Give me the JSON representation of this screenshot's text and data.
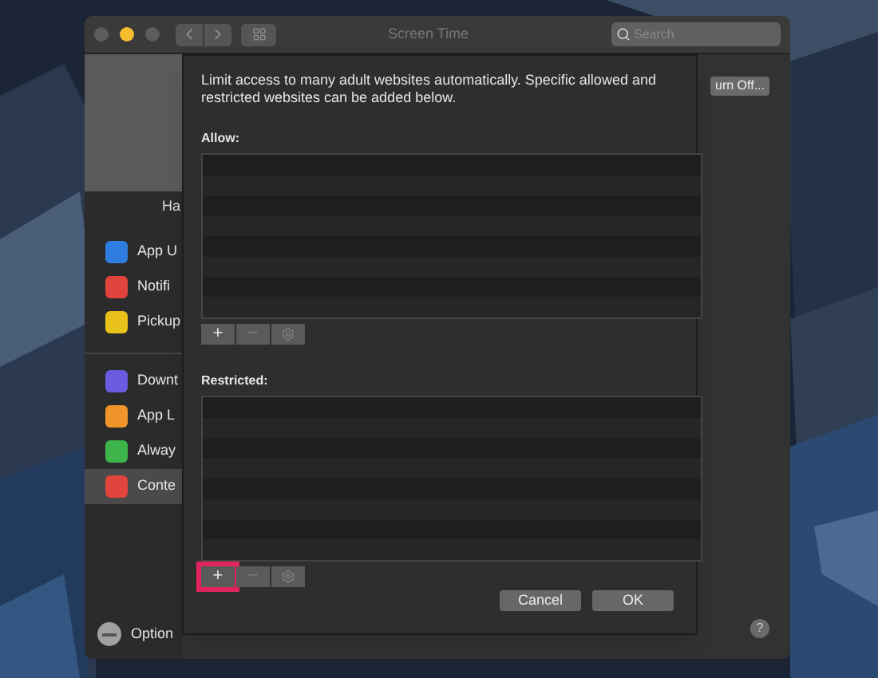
{
  "window": {
    "title": "Screen Time",
    "search": {
      "placeholder": "Search"
    }
  },
  "sidebar": {
    "header": "Ha",
    "sections": [
      {
        "items": [
          {
            "label": "App U",
            "color": "#2f7de1",
            "selected": false
          },
          {
            "label": "Notifi",
            "color": "#e0443c",
            "selected": false
          },
          {
            "label": "Pickup",
            "color": "#e8c21a",
            "selected": false
          }
        ]
      },
      {
        "items": [
          {
            "label": "Downt",
            "color": "#6b5be0",
            "selected": false
          },
          {
            "label": "App L",
            "color": "#f0952a",
            "selected": false
          },
          {
            "label": "Alway",
            "color": "#3cb44a",
            "selected": false
          },
          {
            "label": "Conte",
            "color": "#e0443c",
            "selected": true
          }
        ]
      }
    ],
    "footer": "Option"
  },
  "main": {
    "turn_off_button": "urn Off...",
    "help": "?"
  },
  "sheet": {
    "description": "Limit access to many adult websites automatically. Specific allowed and restricted websites can be added below.",
    "lists": [
      {
        "label": "Allow:",
        "tools": [
          {
            "kind": "add",
            "label": "+",
            "disabled": false,
            "highlighted": false
          },
          {
            "kind": "remove",
            "label": "−",
            "disabled": true,
            "highlighted": false
          },
          {
            "kind": "gear",
            "disabled": true,
            "highlighted": false
          }
        ]
      },
      {
        "label": "Restricted:",
        "tools": [
          {
            "kind": "add",
            "label": "+",
            "disabled": false,
            "highlighted": true
          },
          {
            "kind": "remove",
            "label": "−",
            "disabled": true,
            "highlighted": false
          },
          {
            "kind": "gear",
            "disabled": true,
            "highlighted": false
          }
        ]
      }
    ],
    "buttons": [
      "Cancel",
      "OK"
    ]
  }
}
